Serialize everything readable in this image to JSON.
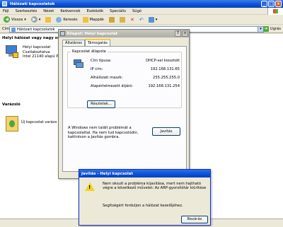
{
  "window": {
    "title": "Hálózati kapcsolatok"
  },
  "menu": [
    "Fájl",
    "Szerkesztés",
    "Nézet",
    "Kedvencek",
    "Eszközök",
    "Speciális",
    "Súgó"
  ],
  "toolbar": {
    "back": "Vissza",
    "search": "Keresés",
    "folders": "Mappák"
  },
  "address": {
    "label": "Cím",
    "value": "Hálózati kapcsolatok",
    "go": "Ugrás"
  },
  "left_pane": {
    "group_header": "Helyi hálózat vagy nagy sebe",
    "connection": {
      "name": "Helyi kapcsolat",
      "state": "Csatlakoztatva",
      "adapter": "Intel 21140 alapú P("
    },
    "wizard_header": "Varázsló",
    "wizard_item": "Új kapcsolat varázs"
  },
  "status_dialog": {
    "title": "Állapot: Helyi kapcsolat",
    "tabs": [
      "Általános",
      "Támogatás"
    ],
    "group": "Kapcsolat állapota",
    "rows": [
      {
        "label": "Cím típusa:",
        "value": "DHCP-vel kiosztott"
      },
      {
        "label": "IP cím:",
        "value": "192.168.131.65"
      },
      {
        "label": "Alhálózati maszk:",
        "value": "255.255.255.0"
      },
      {
        "label": "Alapértelmezett átjáró:",
        "value": "192.168.131.254"
      }
    ],
    "details_button": "Részletek...",
    "repair_text": "A Windows nem talált problémát a kapcsolattal. Ha nem tud kapcsolódni, kattintson a Javítás gombra.",
    "repair_button": "Javítás"
  },
  "repair_dialog": {
    "title": "Javítás - Helyi kapcsolat",
    "message": "Nem oksult a probléma kijavítása, mert nem hajtható végre a következő művelet: Az ARP-gyorsítótár kiürítése",
    "help": "Segítségért forduljon a hálózat kezelőjéhez.",
    "close_button": "Bezárás"
  }
}
